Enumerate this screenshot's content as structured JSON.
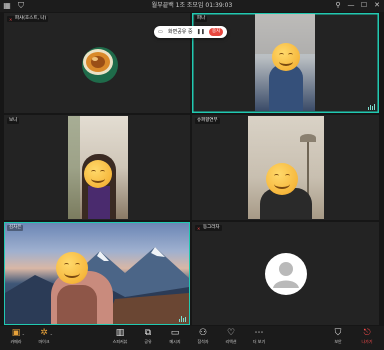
{
  "window": {
    "title": "월부끝백 1조 조모임 01:39:03",
    "left_icons": [
      "grid-icon",
      "shield-check-icon"
    ],
    "right_icons": [
      "pin-icon",
      "minimize-icon",
      "maximize-icon",
      "close-icon"
    ]
  },
  "share_indicator": {
    "label": "화면공유 중",
    "stop_label": "중지"
  },
  "tiles": [
    {
      "name": "파샤(호스트, 나)",
      "muted": true,
      "speaking": false
    },
    {
      "name": "파나",
      "muted": false,
      "speaking": true
    },
    {
      "name": "보니",
      "muted": false,
      "speaking": false
    },
    {
      "name": "슈퍼향연부",
      "muted": false,
      "speaking": false
    },
    {
      "name": "김차은",
      "muted": false,
      "speaking": true
    },
    {
      "name": "동그라차",
      "muted": true,
      "speaking": false
    }
  ],
  "toolbar": {
    "left": [
      {
        "icon": "camera-off-icon",
        "label": "카메라"
      },
      {
        "icon": "mic-off-icon",
        "label": "마이크"
      }
    ],
    "center": [
      {
        "icon": "layout-icon",
        "label": "스피커뷰"
      },
      {
        "icon": "screen-share-icon",
        "label": "공유"
      },
      {
        "icon": "chat-icon",
        "label": "메시지"
      },
      {
        "icon": "participants-icon",
        "label": "참석자"
      },
      {
        "icon": "reaction-icon",
        "label": "리액션"
      },
      {
        "icon": "more-icon",
        "label": "더 보기"
      }
    ],
    "right": [
      {
        "icon": "security-icon",
        "label": "보안"
      },
      {
        "icon": "leave-icon",
        "label": "나가기"
      }
    ]
  },
  "colors": {
    "active_border": "#21c9b1",
    "leave": "#ff4d4d",
    "stop": "#e8473f"
  }
}
